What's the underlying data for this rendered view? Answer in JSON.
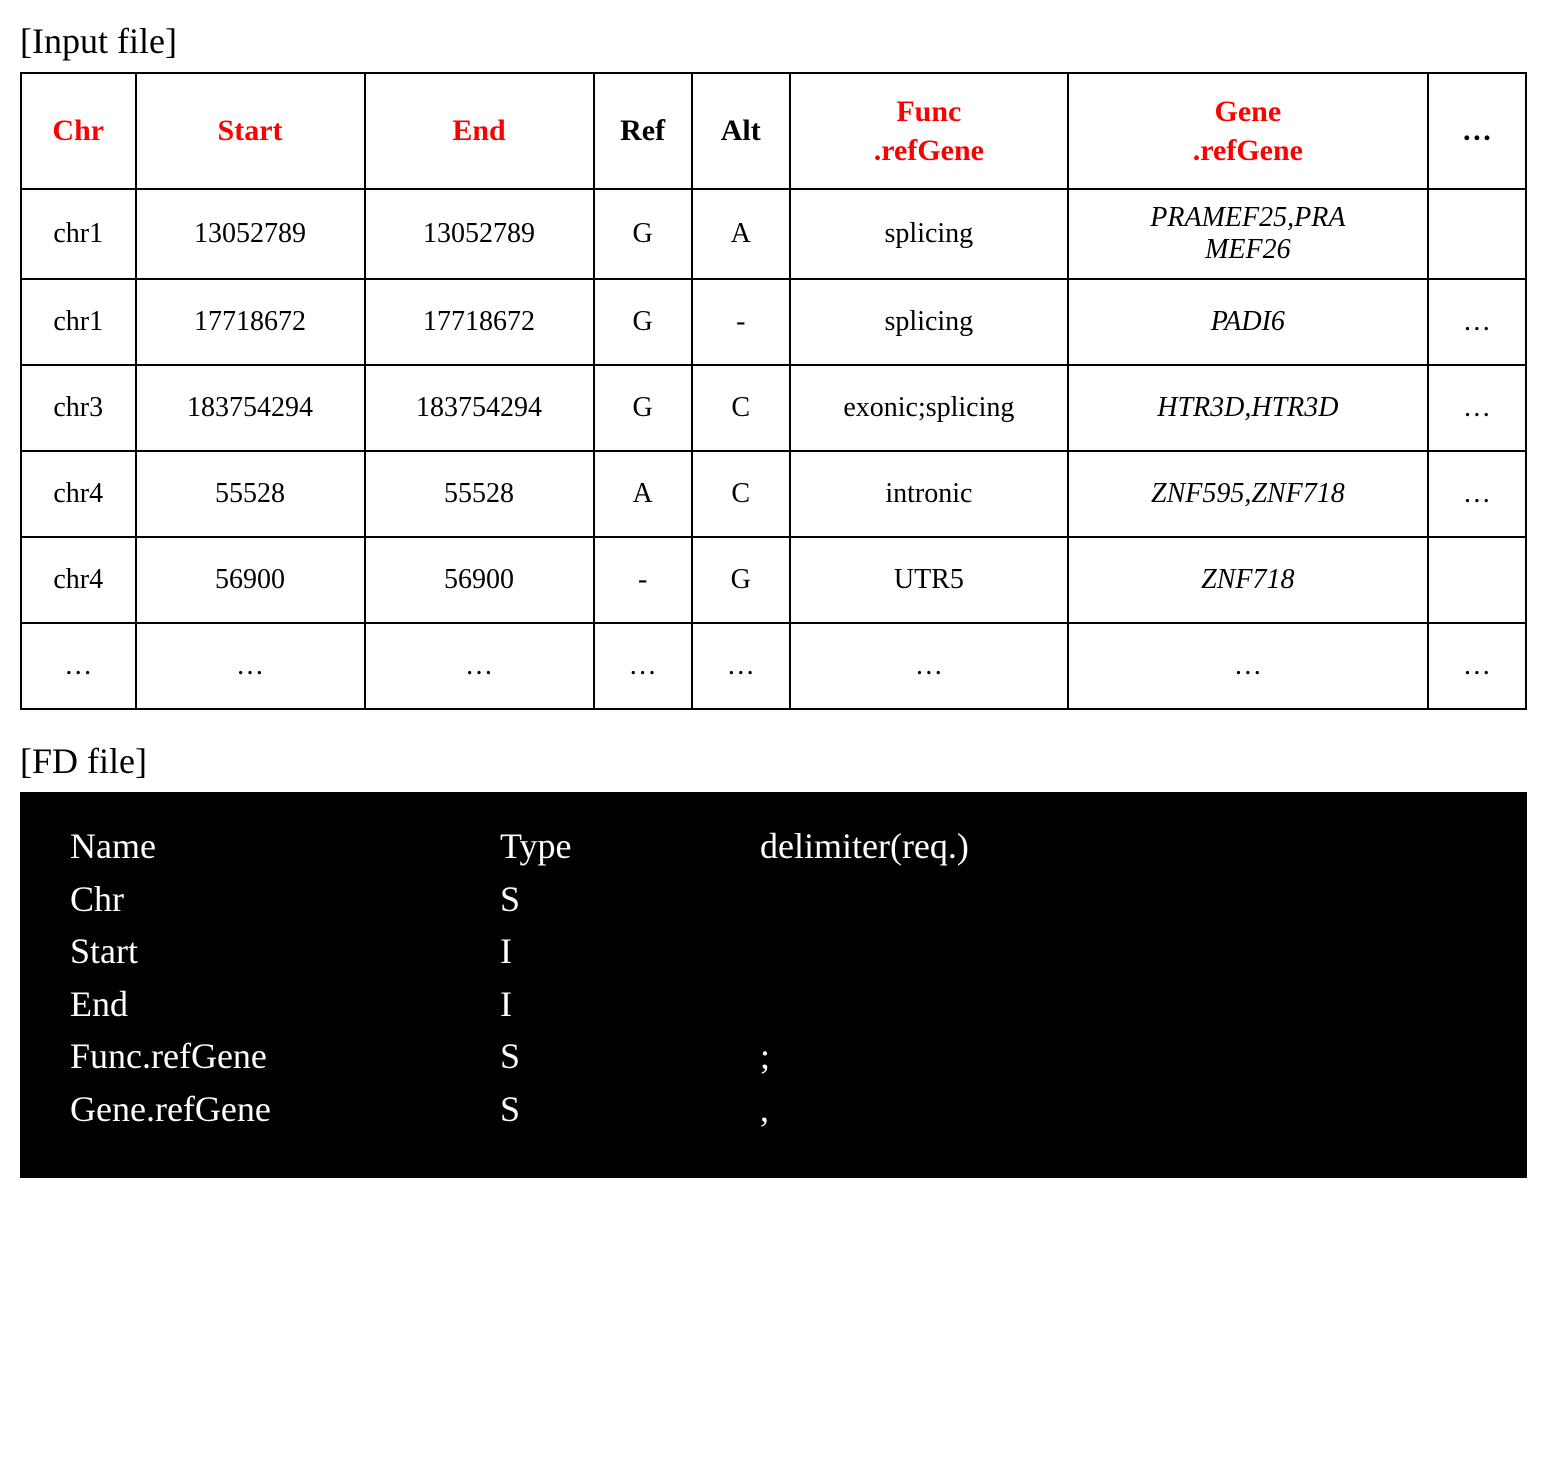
{
  "labels": {
    "input_file": "[Input file]",
    "fd_file": "[FD file]"
  },
  "input_table": {
    "headers": {
      "chr": "Chr",
      "start": "Start",
      "end": "End",
      "ref": "Ref",
      "alt": "Alt",
      "func_line1": "Func",
      "func_line2": ".refGene",
      "gene_line1": "Gene",
      "gene_line2": ".refGene",
      "more": "…"
    },
    "rows": [
      {
        "chr": "chr1",
        "start": "13052789",
        "end": "13052789",
        "ref": "G",
        "alt": "A",
        "func": "splicing",
        "gene_line1": "PRAMEF25,PRA",
        "gene_line2": "MEF26",
        "more": ""
      },
      {
        "chr": "chr1",
        "start": "17718672",
        "end": "17718672",
        "ref": "G",
        "alt": "-",
        "func": "splicing",
        "gene": "PADI6",
        "more": "…"
      },
      {
        "chr": "chr3",
        "start": "183754294",
        "end": "183754294",
        "ref": "G",
        "alt": "C",
        "func": "exonic;splicing",
        "gene": "HTR3D,HTR3D",
        "more": "…"
      },
      {
        "chr": "chr4",
        "start": "55528",
        "end": "55528",
        "ref": "A",
        "alt": "C",
        "func": "intronic",
        "gene": "ZNF595,ZNF718",
        "more": "…"
      },
      {
        "chr": "chr4",
        "start": "56900",
        "end": "56900",
        "ref": "-",
        "alt": "G",
        "func": "UTR5",
        "gene": "ZNF718",
        "more": ""
      },
      {
        "chr": "…",
        "start": "…",
        "end": "…",
        "ref": "…",
        "alt": "…",
        "func": "…",
        "gene": "…",
        "more": "…"
      }
    ]
  },
  "fd_file": {
    "header": {
      "name": "Name",
      "type": "Type",
      "delim": "delimiter(req.)"
    },
    "rows": [
      {
        "name": "Chr",
        "type": "S",
        "delim": ""
      },
      {
        "name": "Start",
        "type": "I",
        "delim": ""
      },
      {
        "name": "End",
        "type": "I",
        "delim": ""
      },
      {
        "name": "Func.refGene",
        "type": "S",
        "delim": ";"
      },
      {
        "name": "Gene.refGene",
        "type": "S",
        "delim": ","
      }
    ]
  }
}
